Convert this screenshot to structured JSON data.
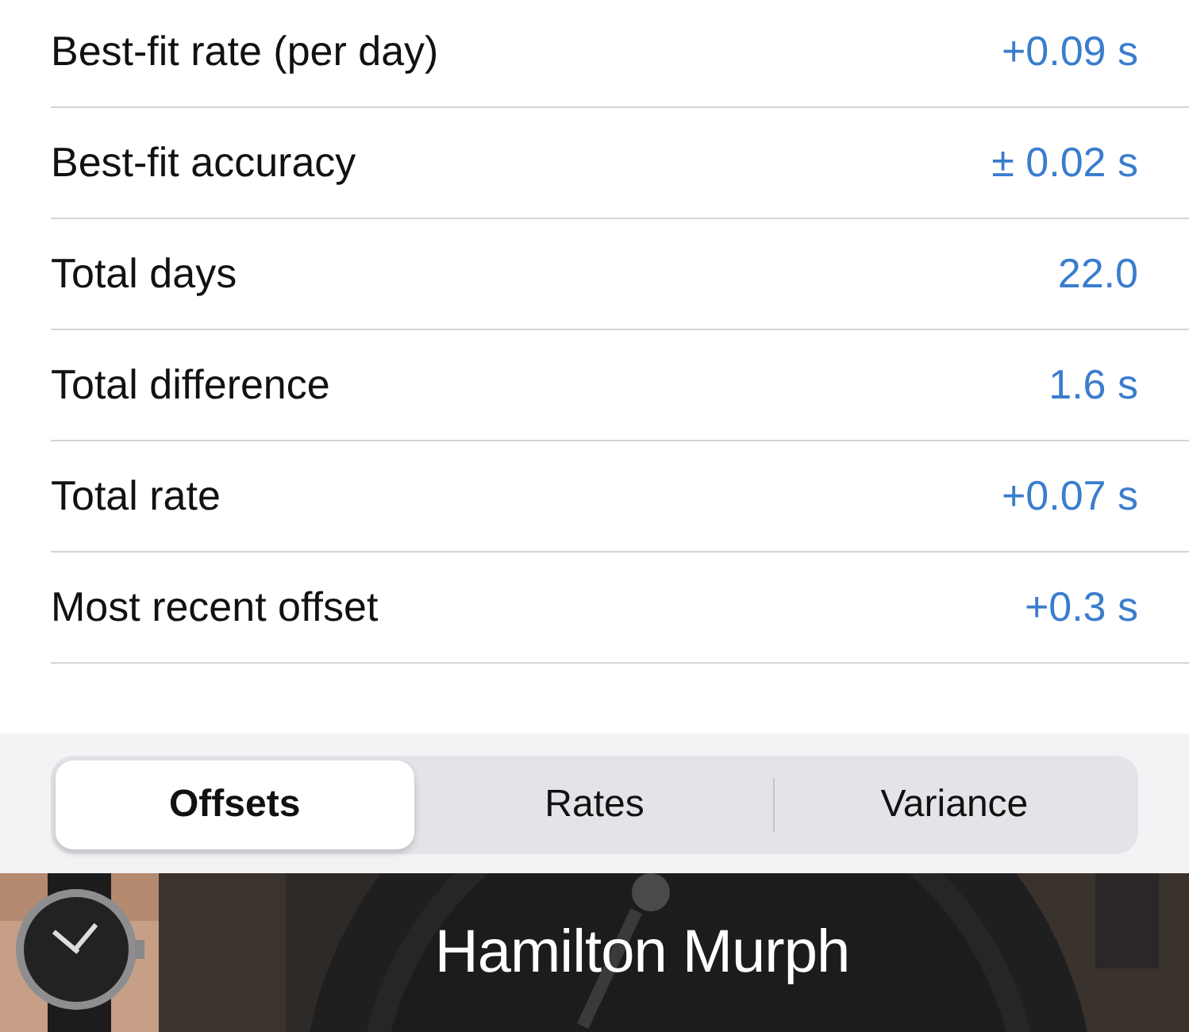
{
  "stats": [
    {
      "label": "Best-fit rate (per day)",
      "value": "+0.09 s"
    },
    {
      "label": "Best-fit accuracy",
      "value": "± 0.02 s"
    },
    {
      "label": "Total days",
      "value": "22.0"
    },
    {
      "label": "Total difference",
      "value": "1.6 s"
    },
    {
      "label": "Total rate",
      "value": "+0.07 s"
    },
    {
      "label": "Most recent offset",
      "value": "+0.3 s"
    }
  ],
  "segments": [
    {
      "label": "Offsets",
      "selected": true
    },
    {
      "label": "Rates",
      "selected": false
    },
    {
      "label": "Variance",
      "selected": false
    }
  ],
  "watch": {
    "title": "Hamilton Murph"
  }
}
